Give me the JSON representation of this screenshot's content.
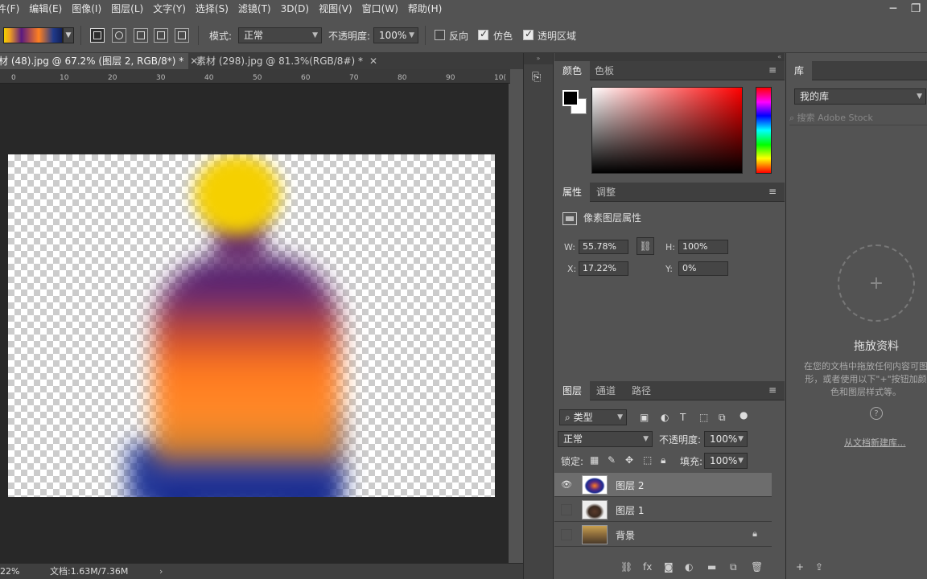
{
  "menu": [
    "件(F)",
    "编辑(E)",
    "图像(I)",
    "图层(L)",
    "文字(Y)",
    "选择(S)",
    "滤镜(T)",
    "3D(D)",
    "视图(V)",
    "窗口(W)",
    "帮助(H)"
  ],
  "window_controls": [
    "─",
    "❐"
  ],
  "options": {
    "mode_label": "模式:",
    "mode_value": "正常",
    "opacity_label": "不透明度:",
    "opacity_value": "100%",
    "reverse_label": "反向",
    "dither_label": "仿色",
    "transparency_label": "透明区域",
    "reverse_checked": false,
    "dither_checked": true,
    "transparency_checked": true
  },
  "tabs": [
    {
      "label": "材 (48).jpg @ 67.2% (图层 2, RGB/8*) *",
      "active": true
    },
    {
      "label": "素材 (298).jpg @ 81.3%(RGB/8#) *",
      "active": false
    }
  ],
  "ruler": [
    "0",
    "10",
    "20",
    "30",
    "40",
    "50",
    "60",
    "70",
    "80",
    "90",
    "10("
  ],
  "status": {
    "zoom": "22%",
    "doc_info": "文档:1.63M/7.36M"
  },
  "color_panel": {
    "tabs": [
      "颜色",
      "色板"
    ],
    "fg_color": "#000000",
    "bg_color": "#ffffff"
  },
  "properties_panel": {
    "tabs": [
      "属性",
      "调整"
    ],
    "title": "像素图层属性",
    "w_label": "W:",
    "w_value": "55.78%",
    "h_label": "H:",
    "h_value": "100%",
    "x_label": "X:",
    "x_value": "17.22%",
    "y_label": "Y:",
    "y_value": "0%"
  },
  "layers_panel": {
    "tabs": [
      "图层",
      "通道",
      "路径"
    ],
    "filter_label": "类型",
    "blend_mode": "正常",
    "opacity_label": "不透明度:",
    "opacity_value": "100%",
    "lock_label": "锁定:",
    "fill_label": "填充:",
    "fill_value": "100%",
    "layers": [
      {
        "name": "图层 2",
        "visible": true,
        "selected": true,
        "locked": false
      },
      {
        "name": "图层 1",
        "visible": false,
        "selected": false,
        "locked": false
      },
      {
        "name": "背景",
        "visible": false,
        "selected": false,
        "locked": true
      }
    ]
  },
  "library_panel": {
    "tab": "库",
    "library_select": "我的库",
    "search_placeholder": "搜索 Adobe Stock",
    "drop_title": "拖放资料",
    "drop_desc": "在您的文档中拖放任何内容可图形，或者使用以下\"+\"按钮加颜色和图层样式等。",
    "help": "?",
    "new_from_doc": "从文档新建库..."
  }
}
